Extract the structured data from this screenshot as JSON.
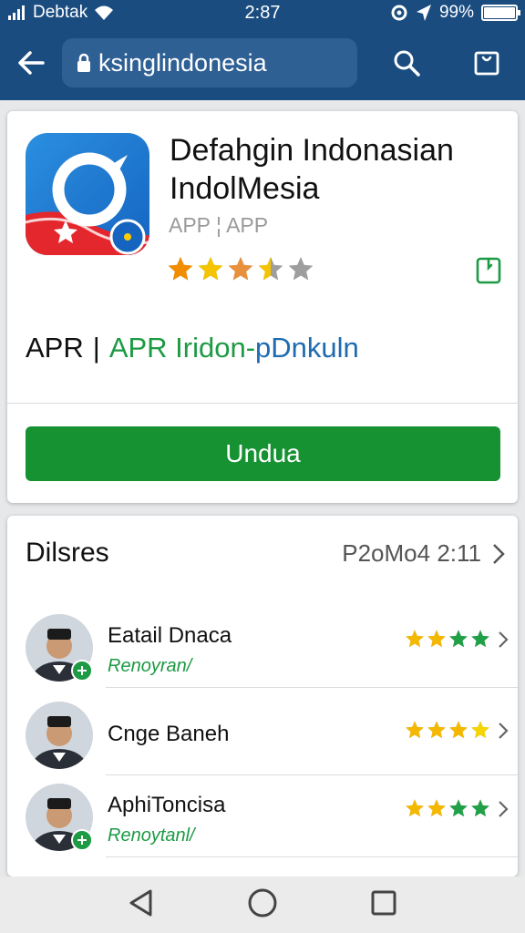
{
  "status_bar": {
    "carrier": "Debtak",
    "time": "2:87",
    "battery": "99%",
    "battery_level": 0.99
  },
  "topbar": {
    "url": "ksinglindonesia"
  },
  "app": {
    "title_line1": "Defahgin Indonasian",
    "title_line2": "IndolMesia",
    "category": "APP ¦ APP",
    "rating": 3.5,
    "info_left": "APR",
    "info_sep": "|",
    "info_green": "APR Iridon-",
    "info_blue": "pDnkuln",
    "download_label": "Undua"
  },
  "reviews": {
    "title": "Dilsres",
    "meta": "P2oMo4 2:11",
    "items": [
      {
        "name": "Eatail Dnaca",
        "tag": "Renoyran/",
        "verified": true,
        "stars": 4
      },
      {
        "name": "Cnge Baneh",
        "tag": "",
        "verified": false,
        "stars": 4
      },
      {
        "name": "AphiToncisa",
        "tag": "Renoytanl/",
        "verified": true,
        "stars": 4
      }
    ]
  },
  "colors": {
    "header_bg": "#1a4c80",
    "download_bg": "#179233",
    "accent_green": "#1d9a44",
    "star_gold": "#f5b800",
    "star_green": "#20a047"
  }
}
